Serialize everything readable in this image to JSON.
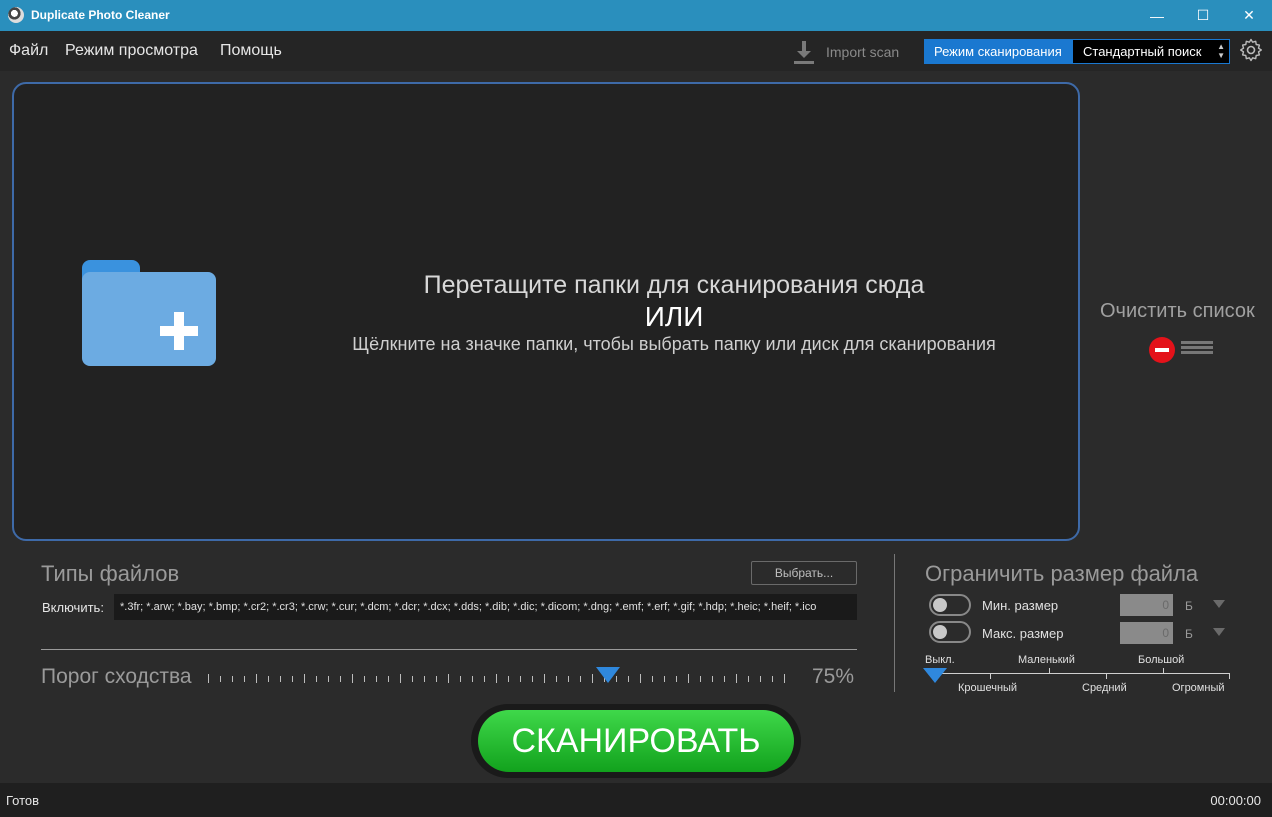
{
  "window": {
    "title": "Duplicate Photo Cleaner",
    "minimize": "—",
    "maximize": "☐",
    "close": "✕"
  },
  "menu": {
    "file": "Файл",
    "view_mode": "Режим просмотра",
    "help": "Помощь"
  },
  "toolbar": {
    "import_scan": "Import scan",
    "scan_mode_label": "Режим сканирования",
    "scan_mode_value": "Стандартный поиск",
    "settings_icon": "gear-icon"
  },
  "dropzone": {
    "line1": "Перетащите папки для сканирования сюда",
    "line2": "ИЛИ",
    "line3": "Щёлкните на значке папки, чтобы выбрать папку или диск для сканирования",
    "icon": "folder-add-icon"
  },
  "clear_list": {
    "title": "Очистить список"
  },
  "file_types": {
    "title": "Типы файлов",
    "choose": "Выбрать...",
    "include_label": "Включить:",
    "include_value": "*.3fr; *.arw; *.bay; *.bmp; *.cr2; *.cr3; *.crw; *.cur; *.dcm; *.dcr; *.dcx; *.dds; *.dib; *.dic; *.dicom; *.dng; *.emf; *.erf; *.gif; *.hdp; *.heic; *.heif; *.ico"
  },
  "similarity": {
    "label": "Порог сходства",
    "value_text": "75%",
    "value": 75
  },
  "size_limit": {
    "title": "Ограничить размер файла",
    "min_label": "Мин. размер",
    "max_label": "Макс. размер",
    "min_value": "0",
    "max_value": "0",
    "unit": "Б",
    "scale": {
      "off": "Выкл.",
      "tiny": "Крошечный",
      "small": "Маленький",
      "medium": "Средний",
      "large": "Большой",
      "huge": "Огромный"
    }
  },
  "scan_button": "СКАНИРОВАТЬ",
  "status": {
    "text": "Готов",
    "timer": "00:00:00"
  },
  "colors": {
    "titlebar": "#2a8fbd",
    "accent": "#1a78d0",
    "scan_green": "#22b82e",
    "clear_red": "#e4121a"
  }
}
